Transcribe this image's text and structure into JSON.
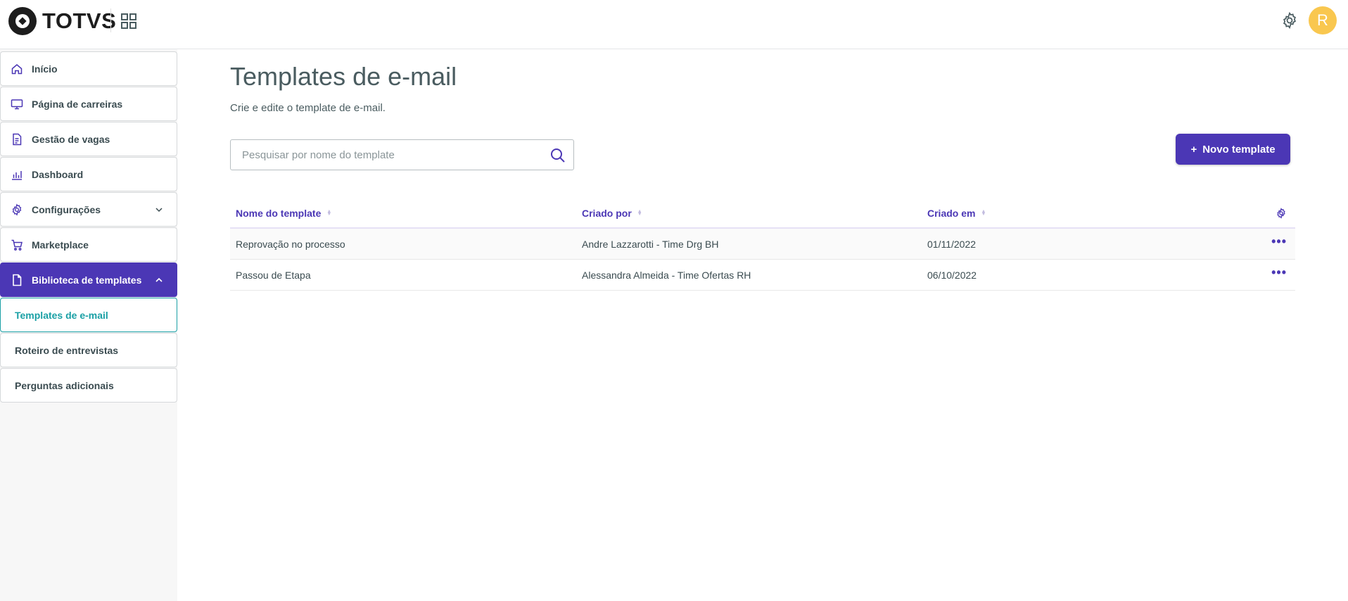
{
  "header": {
    "logo_text": "TOTVS",
    "avatar_initial": "R",
    "brand_color": "#4b37b5",
    "avatar_color": "#f9c74f"
  },
  "sidebar": {
    "items": [
      {
        "label": "Início",
        "icon": "home-icon"
      },
      {
        "label": "Página de carreiras",
        "icon": "monitor-icon"
      },
      {
        "label": "Gestão de vagas",
        "icon": "document-icon"
      },
      {
        "label": "Dashboard",
        "icon": "bar-chart-icon"
      },
      {
        "label": "Configurações",
        "icon": "gear-icon"
      },
      {
        "label": "Marketplace",
        "icon": "cart-icon"
      },
      {
        "label": "Biblioteca de templates",
        "icon": "document-icon"
      }
    ],
    "subitems": [
      {
        "label": "Templates de e-mail"
      },
      {
        "label": "Roteiro de entrevistas"
      },
      {
        "label": "Perguntas adicionais"
      }
    ]
  },
  "main": {
    "title": "Templates de e-mail",
    "subtitle": "Crie e edite o template de e-mail.",
    "search_placeholder": "Pesquisar por nome do template",
    "search_value": "",
    "new_button_label": "Novo template",
    "new_button_icon": "+"
  },
  "table": {
    "columns": [
      "Nome do template",
      "Criado por",
      "Criado em"
    ],
    "rows": [
      {
        "name": "Reprovação no processo",
        "created_by": "Andre Lazzarotti - Time Drg BH",
        "created_at": "01/11/2022"
      },
      {
        "name": "Passou de Etapa",
        "created_by": "Alessandra Almeida - Time Ofertas RH",
        "created_at": "06/10/2022"
      }
    ]
  }
}
